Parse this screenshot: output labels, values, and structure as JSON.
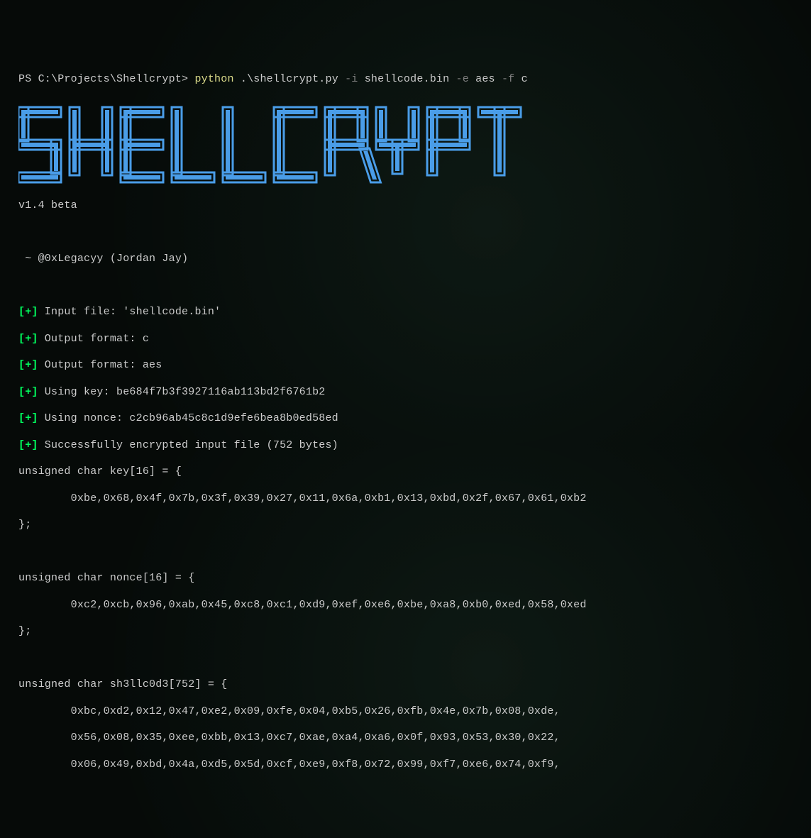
{
  "prompt": "PS C:\\Projects\\Shellcrypt> ",
  "command": {
    "interpreter": "python",
    "script": ".\\shellcrypt.py",
    "flags": [
      "-i",
      "-e",
      "-f"
    ],
    "values": [
      "shellcode.bin",
      "aes",
      "c"
    ]
  },
  "logo": "╔═╗╦ ╦╔═╗╦  ╦  ╔═╗╦═╗╦ ╦╔═╗╔╦╗\n╚═╗╠═╣║╣ ║  ║  ║  ╠╦╝╚╦╝╠═╝ ║ \n╚═╝╩ ╩╚═╝╩═╝╩═╝╚═╝╩╚═ ╩ ╩   ╩ ",
  "version": "v1.4 beta",
  "author": " ~ @0xLegacyy (Jordan Jay)",
  "info_marker": "[+]",
  "info_lines": {
    "l0": " Input file: 'shellcode.bin'",
    "l1": " Output format: c",
    "l2": " Output format: aes",
    "l3": " Using key: be684f7b3f3927116ab113bd2f6761b2",
    "l4": " Using nonce: c2cb96ab45c8c1d9efe6bea8b0ed58ed",
    "l5": " Successfully encrypted input file (752 bytes)"
  },
  "output": {
    "key_decl": "unsigned char key[16] = {",
    "key_bytes": "        0xbe,0x68,0x4f,0x7b,0x3f,0x39,0x27,0x11,0x6a,0xb1,0x13,0xbd,0x2f,0x67,0x61,0xb2",
    "close": "};",
    "nonce_decl": "unsigned char nonce[16] = {",
    "nonce_bytes": "        0xc2,0xcb,0x96,0xab,0x45,0xc8,0xc1,0xd9,0xef,0xe6,0xbe,0xa8,0xb0,0xed,0x58,0xed",
    "sh_decl": "unsigned char sh3llc0d3[752] = {",
    "sh_l0": "        0xbc,0xd2,0x12,0x47,0xe2,0x09,0xfe,0x04,0xb5,0x26,0xfb,0x4e,0x7b,0x08,0xde,",
    "sh_l1": "        0x56,0x08,0x35,0xee,0xbb,0x13,0xc7,0xae,0xa4,0xa6,0x0f,0x93,0x53,0x30,0x22,",
    "sh_l2": "        0x06,0x49,0xbd,0x4a,0xd5,0x5d,0xcf,0xe9,0xf8,0x72,0x99,0xf7,0xe6,0x74,0xf9,"
  }
}
